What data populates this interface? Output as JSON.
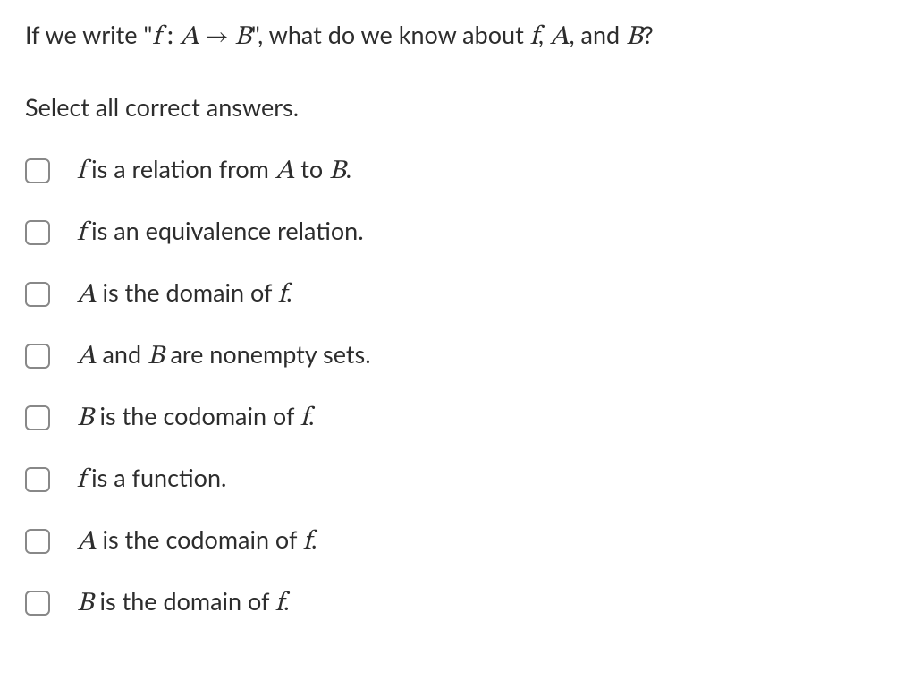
{
  "question": {
    "prefix": "If we write \"",
    "math_f": "f",
    "math_colon": " : ",
    "math_A": "A",
    "math_arrow": " → ",
    "math_B": "B",
    "mid": "\", what do we know about ",
    "math_f2": "f",
    "comma1": ", ",
    "math_A2": "A",
    "comma2": ", and ",
    "math_B2": "B",
    "suffix": "?"
  },
  "instruction": "Select all correct answers.",
  "options": [
    {
      "parts": [
        {
          "type": "math",
          "text": "f"
        },
        {
          "type": "text",
          "text": " is a relation from "
        },
        {
          "type": "math",
          "text": "A"
        },
        {
          "type": "text",
          "text": " to "
        },
        {
          "type": "math",
          "text": "B"
        },
        {
          "type": "text",
          "text": "."
        }
      ]
    },
    {
      "parts": [
        {
          "type": "math",
          "text": "f"
        },
        {
          "type": "text",
          "text": " is an equivalence relation."
        }
      ]
    },
    {
      "parts": [
        {
          "type": "math",
          "text": "A"
        },
        {
          "type": "text",
          "text": " is the domain of "
        },
        {
          "type": "math",
          "text": "f"
        },
        {
          "type": "text",
          "text": "."
        }
      ]
    },
    {
      "parts": [
        {
          "type": "math",
          "text": "A"
        },
        {
          "type": "text",
          "text": " and "
        },
        {
          "type": "math",
          "text": "B"
        },
        {
          "type": "text",
          "text": " are nonempty sets."
        }
      ]
    },
    {
      "parts": [
        {
          "type": "math",
          "text": "B"
        },
        {
          "type": "text",
          "text": " is the codomain of "
        },
        {
          "type": "math",
          "text": "f"
        },
        {
          "type": "text",
          "text": "."
        }
      ]
    },
    {
      "parts": [
        {
          "type": "math",
          "text": "f"
        },
        {
          "type": "text",
          "text": " is a function."
        }
      ]
    },
    {
      "parts": [
        {
          "type": "math",
          "text": "A"
        },
        {
          "type": "text",
          "text": " is the codomain of "
        },
        {
          "type": "math",
          "text": "f"
        },
        {
          "type": "text",
          "text": "."
        }
      ]
    },
    {
      "parts": [
        {
          "type": "math",
          "text": "B"
        },
        {
          "type": "text",
          "text": " is the domain of "
        },
        {
          "type": "math",
          "text": "f"
        },
        {
          "type": "text",
          "text": "."
        }
      ]
    }
  ]
}
